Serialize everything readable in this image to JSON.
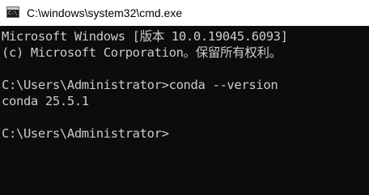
{
  "window": {
    "title": "C:\\windows\\system32\\cmd.exe",
    "app_icon": "cmd-console-icon",
    "app_icon_text": "C:\\"
  },
  "console": {
    "background": "#0c0c0c",
    "foreground": "#cccccc",
    "lines": [
      "Microsoft Windows [版本 10.0.19045.6093]",
      "(c) Microsoft Corporation。保留所有权利。",
      "",
      "C:\\Users\\Administrator>conda --version",
      "conda 25.5.1",
      "",
      "C:\\Users\\Administrator>"
    ]
  }
}
